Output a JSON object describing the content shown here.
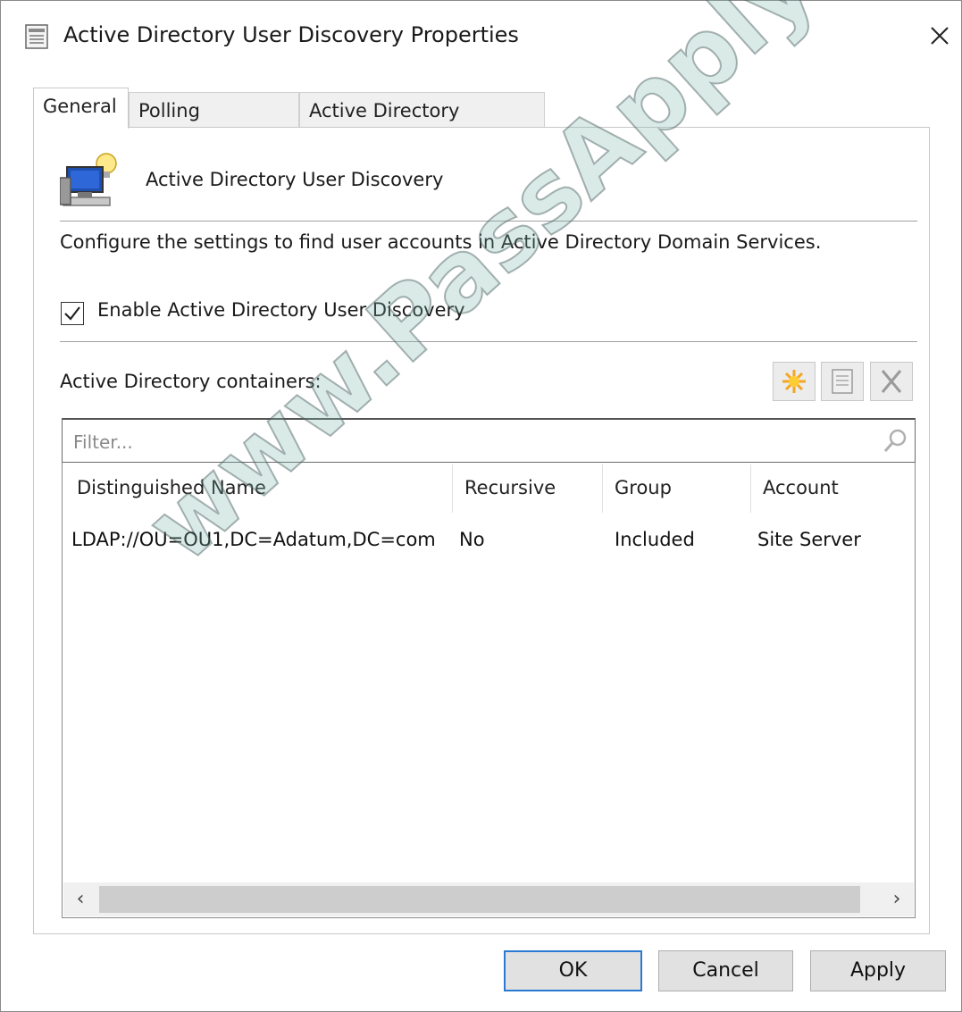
{
  "window": {
    "title": "Active Directory User Discovery Properties"
  },
  "tabs": [
    {
      "label": "General",
      "selected": true
    },
    {
      "label": "Polling Schedule",
      "selected": false
    },
    {
      "label": "Active Directory Attributes",
      "selected": false
    }
  ],
  "general": {
    "header": "Active Directory User Discovery",
    "description": "Configure the settings to find user accounts in Active Directory Domain Services.",
    "enable_checkbox": {
      "label": "Enable Active Directory User Discovery",
      "checked": true
    },
    "containers_label": "Active Directory containers:",
    "toolbar_icons": [
      "new-icon",
      "properties-icon",
      "delete-icon"
    ],
    "filter": {
      "placeholder": "Filter...",
      "value": ""
    },
    "columns": [
      "Distinguished Name",
      "Recursive",
      "Group",
      "Account"
    ],
    "rows": [
      {
        "distinguished_name": "LDAP://OU=OU1,DC=Adatum,DC=com",
        "recursive": "No",
        "group": "Included",
        "account": "Site Server"
      }
    ]
  },
  "buttons": {
    "ok": "OK",
    "cancel": "Cancel",
    "apply": "Apply"
  },
  "watermark": "www.PassApply.com",
  "colors": {
    "ok_border": "#2a7ad2",
    "button_bg": "#e1e1e1",
    "new_icon": "#f5a623"
  }
}
